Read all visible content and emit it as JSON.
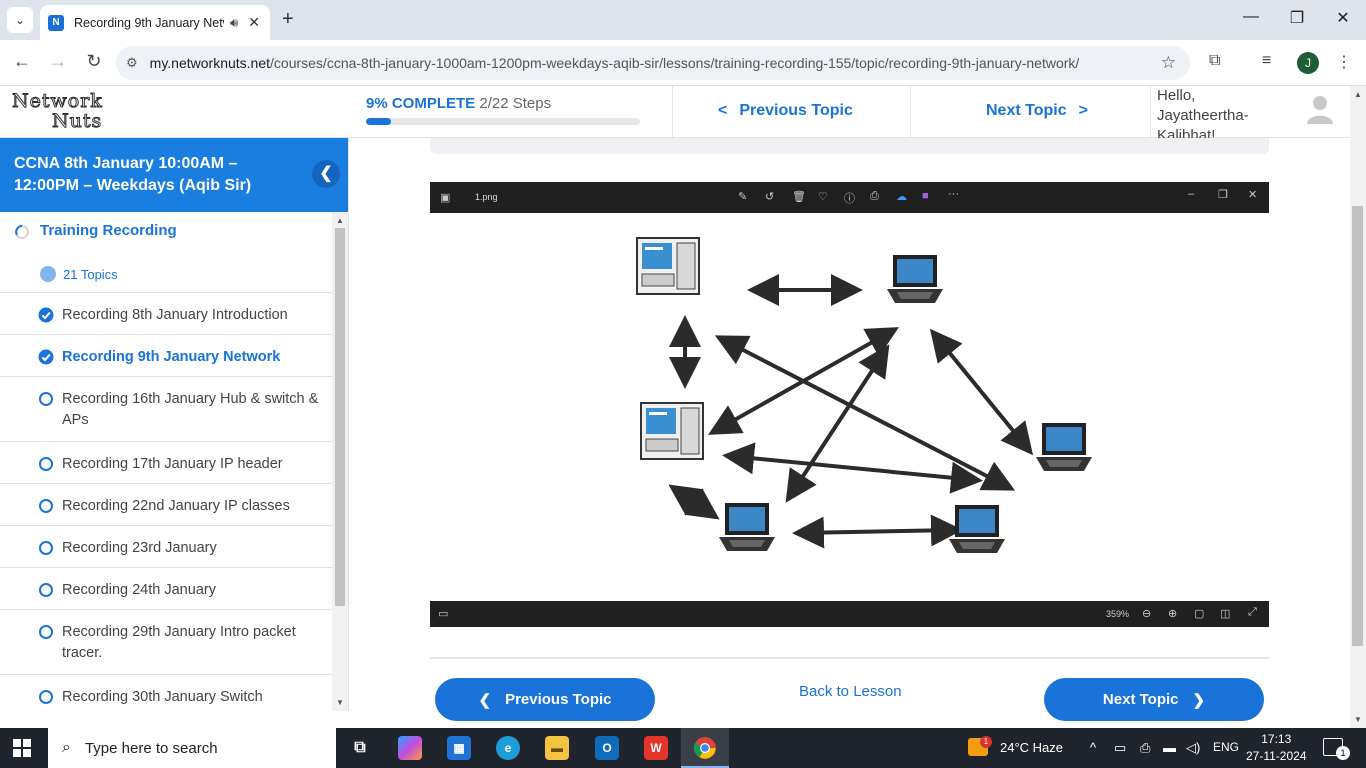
{
  "browser": {
    "tab_title": "Recording 9th January Netw",
    "url_domain": "my.networknuts.net",
    "url_path": "/courses/ccna-8th-january-1000am-1200pm-weekdays-aqib-sir/lessons/training-recording-155/topic/recording-9th-january-network/",
    "profile_initial": "J"
  },
  "header": {
    "logo_line1": "Network",
    "logo_line2": "Nuts",
    "progress_percent_label": "9% COMPLETE",
    "progress_steps": "2/22 Steps",
    "progress_fraction": 0.09,
    "prev_topic": "Previous Topic",
    "next_topic": "Next Topic",
    "greeting": "Hello, Jayatheertha-Kalibhat!"
  },
  "sidebar": {
    "course_title": "CCNA 8th January 10:00AM – 12:00PM – Weekdays (Aqib Sir)",
    "lesson_title": "Training Recording",
    "topics_count": "21 Topics",
    "topics": [
      {
        "label": "Recording 8th January Introduction",
        "status": "done"
      },
      {
        "label": "Recording 9th January Network",
        "status": "current"
      },
      {
        "label": "Recording 16th January Hub & switch & APs",
        "status": "todo"
      },
      {
        "label": "Recording 17th January IP header",
        "status": "todo"
      },
      {
        "label": "Recording 22nd January IP classes",
        "status": "todo"
      },
      {
        "label": "Recording 23rd January",
        "status": "todo"
      },
      {
        "label": "Recording 24th January",
        "status": "todo"
      },
      {
        "label": "Recording 29th January Intro packet tracer.",
        "status": "todo"
      },
      {
        "label": "Recording 30th January Switch",
        "status": "todo"
      }
    ]
  },
  "viewer": {
    "file_name": "1.png",
    "zoom": "359%"
  },
  "footer_nav": {
    "prev": "Previous Topic",
    "back": "Back to Lesson",
    "next": "Next Topic"
  },
  "taskbar": {
    "search_placeholder": "Type here to search",
    "weather": "24°C  Haze",
    "weather_badge": "1",
    "language": "ENG",
    "time": "17:13",
    "date": "27-11-2024",
    "notification_count": "1"
  },
  "colors": {
    "accent": "#1a73d9",
    "sidebar_header": "#1a7ee0"
  }
}
